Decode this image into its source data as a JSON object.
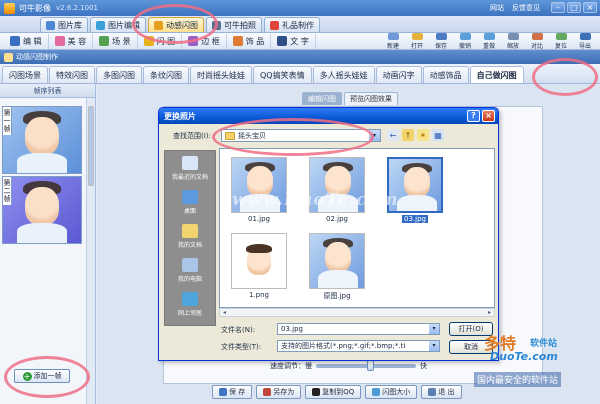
{
  "window": {
    "title": "可牛影像",
    "version": "v2.6.2.1001",
    "links": [
      "网站",
      "反馈意见"
    ],
    "min_glyph": "–",
    "max_glyph": "□",
    "close_glyph": "×"
  },
  "module_tabs": [
    {
      "label": "图片库",
      "icon": "gallery-icon",
      "active": false
    },
    {
      "label": "图片编辑",
      "icon": "edit-photo-icon",
      "active": false
    },
    {
      "label": "动感闪图",
      "icon": "flash-image-icon",
      "active": true
    },
    {
      "label": "可牛拍照",
      "icon": "camera-icon",
      "active": false
    },
    {
      "label": "礼品制作",
      "icon": "gift-icon",
      "active": false
    }
  ],
  "tools": [
    {
      "label": "编 辑",
      "icon": "edit-icon"
    },
    {
      "label": "美 容",
      "icon": "beauty-icon"
    },
    {
      "label": "场 景",
      "icon": "scene-icon"
    },
    {
      "label": "闪 图",
      "icon": "flash-icon"
    },
    {
      "label": "边 框",
      "icon": "frame-icon"
    },
    {
      "label": "饰 品",
      "icon": "accessory-icon"
    },
    {
      "label": "文 字",
      "icon": "text-icon"
    }
  ],
  "actions": [
    "新建",
    "打开",
    "保存",
    "撤销",
    "重做",
    "缩放",
    "对比",
    "复位",
    "导出"
  ],
  "section_title": "动感闪图制作",
  "style_tabs": [
    "闪图场景",
    "特效闪图",
    "多图闪图",
    "条纹闪图",
    "时尚摇头娃娃",
    "QQ搞笑表情",
    "多人摇头娃娃",
    "动画闪字",
    "动感饰品",
    "自己做闪图"
  ],
  "active_style_tab": 9,
  "frame_list": {
    "title": "帧序列表",
    "frames": [
      {
        "label": "第一帧"
      },
      {
        "label": "第二帧"
      }
    ],
    "add_label": "添加一帧",
    "add_glyph": "+"
  },
  "edit_tabs": [
    "编辑闪图",
    "预览闪图效果"
  ],
  "dialog": {
    "title": "更换照片",
    "help_glyph": "?",
    "close_glyph": "×",
    "look_in_label": "查找范围(I):",
    "look_in_value": "摇头宝贝",
    "tool_glyphs": [
      "←",
      "↑",
      "✶",
      "▦"
    ],
    "places": [
      {
        "label": "我最近的文档",
        "icon": "recent-documents-icon"
      },
      {
        "label": "桌面",
        "icon": "desktop-icon"
      },
      {
        "label": "我的文档",
        "icon": "my-documents-icon"
      },
      {
        "label": "我的电脑",
        "icon": "my-computer-icon"
      },
      {
        "label": "网上邻居",
        "icon": "network-icon"
      }
    ],
    "files": [
      {
        "name": "01.jpg",
        "kind": "blue",
        "selected": false
      },
      {
        "name": "02.jpg",
        "kind": "blue",
        "selected": false
      },
      {
        "name": "03.jpg",
        "kind": "blue",
        "selected": true
      },
      {
        "name": "1.png",
        "kind": "plain",
        "selected": false
      },
      {
        "name": "原图.jpg",
        "kind": "blue",
        "selected": false
      }
    ],
    "file_name_label": "文件名(N):",
    "file_name_value": "03.jpg",
    "file_type_label": "文件类型(T):",
    "file_type_value": "支持的图片格式(*.png;*.gif;*.bmp;*.ti",
    "open_label": "打开(O)",
    "cancel_label": "取消",
    "scroll_left": "◂",
    "scroll_right": "▸",
    "dropdown_glyph": "▾"
  },
  "speed": {
    "label": "速度调节：慢",
    "fast_label": "快",
    "value": 0.55
  },
  "bottom_buttons": [
    {
      "label": "保 存",
      "icon": "save-icon"
    },
    {
      "label": "另存为",
      "icon": "save-as-icon"
    },
    {
      "label": "复制到QQ",
      "icon": "qq-icon"
    },
    {
      "label": "闪图大小",
      "icon": "resize-icon"
    },
    {
      "label": "退 出",
      "icon": "exit-icon"
    }
  ],
  "watermarks": {
    "center": "www.DuoTe.com",
    "corner_brand": "多特",
    "corner_brand2": "软件站",
    "corner_domain": "DuoTe.com",
    "corner_slogan": "国内最安全的软件站"
  },
  "colors": {
    "highlight": "#ef6f86",
    "selection": "#316ac5",
    "title_blue": "#0a58d6"
  }
}
